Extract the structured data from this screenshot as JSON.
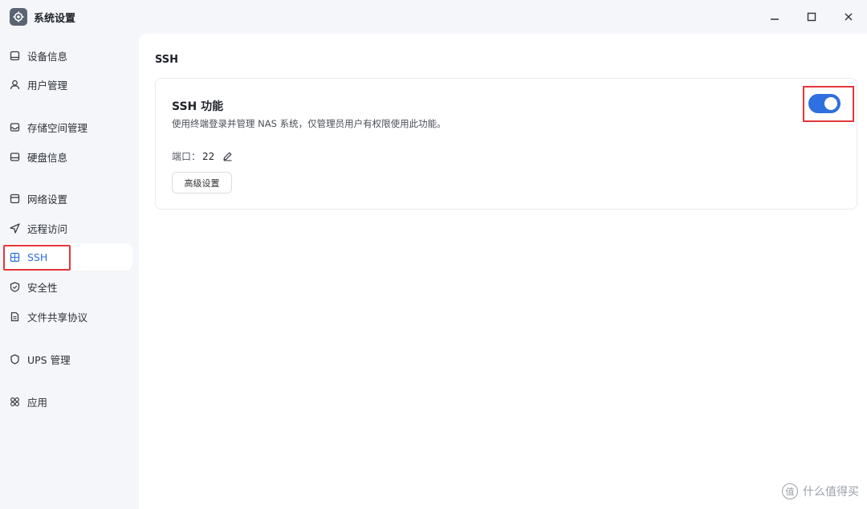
{
  "window": {
    "title": "系统设置",
    "app_icon": "gear-icon",
    "controls": [
      "minimize-icon",
      "maximize-icon",
      "close-icon"
    ]
  },
  "sidebar": {
    "items": [
      {
        "label": "设备信息",
        "icon": "device-icon"
      },
      {
        "label": "用户管理",
        "icon": "user-icon"
      },
      {
        "label": "存储空间管理",
        "icon": "storage-icon"
      },
      {
        "label": "硬盘信息",
        "icon": "disk-icon"
      },
      {
        "label": "网络设置",
        "icon": "network-icon"
      },
      {
        "label": "远程访问",
        "icon": "send-icon"
      },
      {
        "label": "SSH",
        "icon": "terminal-icon",
        "active": true
      },
      {
        "label": "安全性",
        "icon": "shield-icon"
      },
      {
        "label": "文件共享协议",
        "icon": "file-icon"
      },
      {
        "label": "UPS 管理",
        "icon": "battery-icon"
      },
      {
        "label": "应用",
        "icon": "apps-icon"
      }
    ]
  },
  "main": {
    "section_title": "SSH",
    "card": {
      "title": "SSH 功能",
      "description": "使用终端登录并管理 NAS 系统，仅管理员用户有权限使用此功能。",
      "port_label": "端口：",
      "port_value": "22",
      "advanced_button": "高级设置",
      "toggle_on": true
    }
  },
  "watermark": {
    "text": "什么值得买",
    "icon_text": "值"
  },
  "colors": {
    "accent": "#2f6fdf",
    "highlight_box": "#e6363a",
    "sidebar_bg": "#f4f6f9"
  }
}
